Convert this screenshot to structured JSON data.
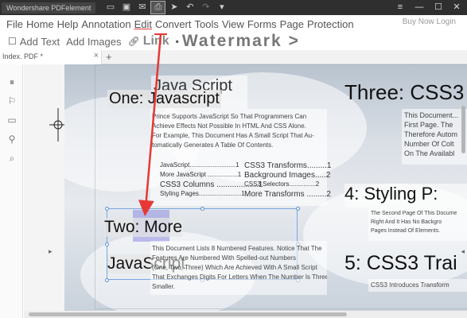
{
  "app": {
    "title": "Wondershare PDFelement"
  },
  "quick_access": [
    {
      "icon": "folder-icon",
      "glyph": "▭"
    },
    {
      "icon": "save-icon",
      "glyph": "▣"
    },
    {
      "icon": "mail-icon",
      "glyph": "✉"
    },
    {
      "icon": "print-icon",
      "glyph": "⎙"
    },
    {
      "icon": "pointer-icon",
      "glyph": "➤"
    },
    {
      "icon": "undo-icon",
      "glyph": "↶"
    },
    {
      "icon": "redo-icon",
      "glyph": "↷"
    },
    {
      "icon": "dropdown-icon",
      "glyph": "▾"
    }
  ],
  "window_controls": {
    "menu": "≡",
    "minimize": "—",
    "maximize": "☐",
    "close": "✕"
  },
  "menu": [
    "File",
    "Home",
    "Help",
    "Annotation",
    "Edit",
    "Convert",
    "Tools",
    "View",
    "Forms",
    "Page",
    "Protection"
  ],
  "buy_now": "Buy Now   Login",
  "toolbar": {
    "add_text": "Add Text",
    "add_images": "Add Images",
    "link": "Link",
    "watermark": "Watermark",
    "more": ">"
  },
  "tab": {
    "label": "Index. PDF *",
    "close": "×",
    "new": "+"
  },
  "document": {
    "heading_one": "One: Javascript",
    "heading_one_hidden": "Java Script",
    "heading_two_a": "Two: More",
    "heading_two_b": "JavaScript",
    "heading_three": "Three: CSS3",
    "heading_four": "4: Styling P:",
    "heading_five": "5: CSS3 Trai",
    "intro_lines": [
      "Prince Supports JavaScript So That Programmers Can",
      "Achieve Effects Not Possible In HTML And CSS Alone.",
      "For Example, This Document Has A Small Script That Au-",
      "tomatically Generates A Table Of Contents."
    ],
    "toc_left": [
      "JavaScript..........................1",
      "More JavaScript .................1",
      "CSS3 Columns ...................1",
      "Styling Pages........................1"
    ],
    "toc_right": [
      "CSS3 Transforms.........1",
      "Background Images.....2",
      "CSS3 Selectors...............2",
      "More Transforms .........2"
    ],
    "two_lines": [
      "This Document Lists 8 Numbered Features. Notice That The",
      "Features Are Numbered With Spelled-out Numbers",
      "(One, Two, Three) Which Are Achieved With A Small Script",
      "That Exchanges Digits For Letters When The Number Is Three Or",
      "Smaller."
    ],
    "three_lines": [
      "This Document...",
      "First Page. The",
      "Therefore Autom",
      "Number Of Colt",
      "On The Availabl"
    ],
    "four_lines": [
      "The Second Page Of This Docume",
      "Right And It Has No Backgro",
      "Pages Instead Of Elements."
    ],
    "five_lines": [
      "CSS3 Introduces Transform"
    ]
  },
  "rail_icons": [
    "thumbnails-icon",
    "bookmark-icon",
    "comment-icon",
    "attachment-icon",
    "search-icon"
  ],
  "colors": {
    "titlebar": "#2f2f2f",
    "accent_red": "#e53935"
  }
}
